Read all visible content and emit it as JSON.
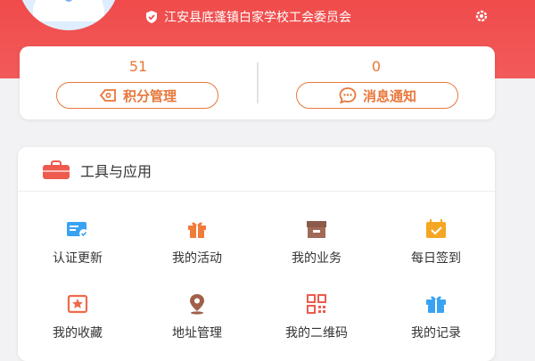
{
  "header": {
    "organization": "江安县底蓬镇白家学校工会委员会"
  },
  "stats": {
    "points": {
      "value": "51",
      "label": "积分管理"
    },
    "messages": {
      "value": "0",
      "label": "消息通知"
    }
  },
  "tools": {
    "title": "工具与应用",
    "items": [
      {
        "label": "认证更新",
        "icon": "id-card-icon"
      },
      {
        "label": "我的活动",
        "icon": "gift-icon"
      },
      {
        "label": "我的业务",
        "icon": "archive-box-icon"
      },
      {
        "label": "每日签到",
        "icon": "calendar-check-icon"
      },
      {
        "label": "我的收藏",
        "icon": "star-frame-icon"
      },
      {
        "label": "地址管理",
        "icon": "location-pin-icon"
      },
      {
        "label": "我的二维码",
        "icon": "qr-code-icon"
      },
      {
        "label": "我的记录",
        "icon": "record-gift-icon"
      }
    ]
  },
  "colors": {
    "header_red": "#f04b4b",
    "accent_orange": "#e8773a",
    "icon_blue": "#3aa2f2"
  }
}
